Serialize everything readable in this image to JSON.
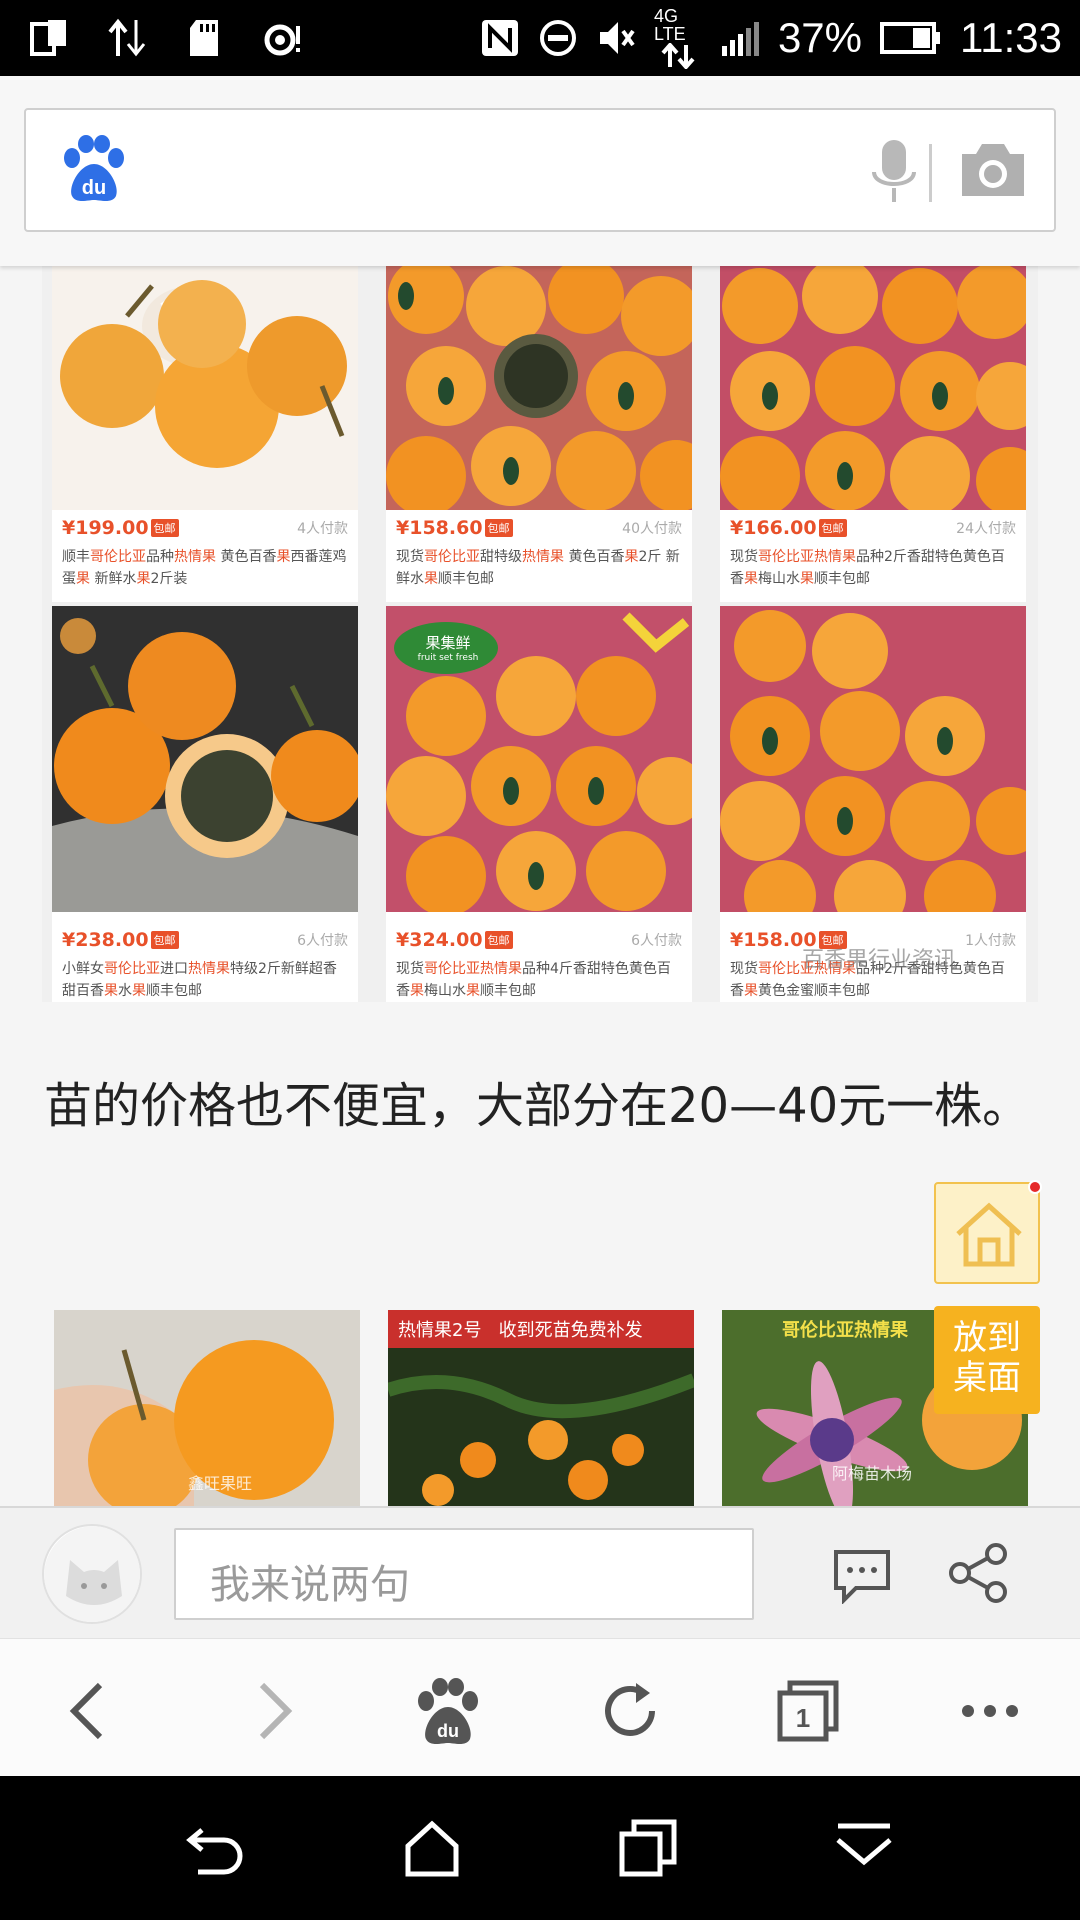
{
  "status_bar": {
    "network": "4G LTE",
    "battery": "37%",
    "time": "11:33"
  },
  "search": {
    "placeholder": ""
  },
  "products": [
    {
      "price": "¥199.00",
      "badge": "包邮",
      "sales": "4人付款",
      "desc_parts": [
        "顺丰",
        "哥伦比亚",
        "品种",
        "热情果",
        " 黄色百香",
        "果",
        "西番莲鸡蛋",
        "果",
        " 新鲜水",
        "果",
        "2斤装"
      ]
    },
    {
      "price": "¥158.60",
      "badge": "包邮",
      "sales": "40人付款",
      "desc_parts": [
        "现货",
        "哥伦比亚",
        "甜特级",
        "热情果",
        " 黄色百香",
        "果",
        "2斤 新鲜水",
        "果",
        "顺丰包邮"
      ]
    },
    {
      "price": "¥166.00",
      "badge": "包邮",
      "sales": "24人付款",
      "desc_parts": [
        "现货",
        "哥伦比亚热情果",
        "品种2斤香甜特色黄色百香",
        "果",
        "梅山水",
        "果",
        "顺丰包邮"
      ]
    },
    {
      "price": "¥238.00",
      "badge": "包邮",
      "sales": "6人付款",
      "desc_parts": [
        "小鲜女",
        "哥伦比亚",
        "进口",
        "热情果",
        "特级2斤新鲜超香甜百香",
        "果",
        "水",
        "果",
        "顺丰包邮"
      ]
    },
    {
      "price": "¥324.00",
      "badge": "包邮",
      "sales": "6人付款",
      "desc_parts": [
        "现货",
        "哥伦比亚热情果",
        "品种4斤香甜特色黄色百香",
        "果",
        "梅山水",
        "果",
        "顺丰包邮"
      ]
    },
    {
      "price": "¥158.00",
      "badge": "包邮",
      "sales": "1人付款",
      "desc_parts": [
        "现货",
        "哥伦比亚热情果",
        "品种2斤香甜特色黄色百香",
        "果",
        "黄色金蜜顺丰包邮"
      ]
    }
  ],
  "product_labels": {
    "card2_tag_cn": "果集鲜",
    "card2_tag_en": "fruit set fresh"
  },
  "watermark": "百香果行业资讯",
  "article": {
    "paragraph": "苗的价格也不便宜，大部分在20—40元一株。"
  },
  "bottom_strip": [
    {
      "caption": "鑫旺果旺"
    },
    {
      "banner": "热情果2号   收到死苗免费补发"
    },
    {
      "banner": "哥伦比亚热情果",
      "caption": "阿梅苗木场"
    }
  ],
  "floating": {
    "desk_label_1": "放到",
    "desk_label_2": "桌面"
  },
  "comment": {
    "placeholder": "我来说两句"
  },
  "icons": {
    "toolbar": [
      "back-icon",
      "forward-icon",
      "baidu-home-icon",
      "refresh-icon",
      "tabs-icon",
      "more-icon"
    ],
    "tabs_count": "1"
  },
  "colors": {
    "accent": "#e8512a",
    "baidu_blue": "#2e6fe6",
    "float_yellow": "#f6b21f"
  }
}
